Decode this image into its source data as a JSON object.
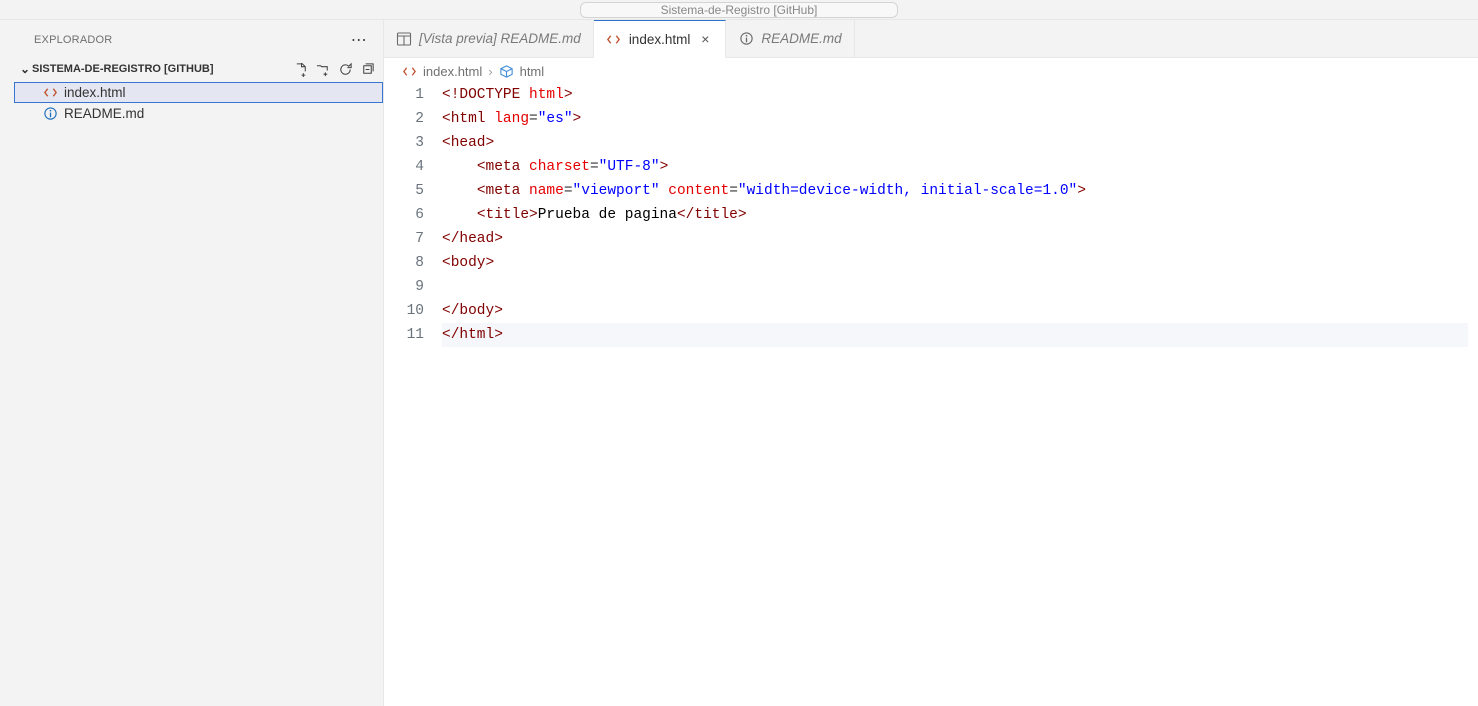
{
  "topbar": {
    "title": "Sistema-de-Registro [GitHub]"
  },
  "sidebar": {
    "title": "EXPLORADOR",
    "section": "SISTEMA-DE-REGISTRO [GITHUB]",
    "files": [
      {
        "name": "index.html",
        "icon": "html",
        "selected": true
      },
      {
        "name": "README.md",
        "icon": "info",
        "selected": false
      }
    ]
  },
  "tabs": [
    {
      "label": "[Vista previa] README.md",
      "icon": "preview",
      "active": false,
      "italic": true,
      "close": false
    },
    {
      "label": "index.html",
      "icon": "html",
      "active": true,
      "italic": false,
      "close": true
    },
    {
      "label": "README.md",
      "icon": "info",
      "active": false,
      "italic": true,
      "close": false
    }
  ],
  "breadcrumb": {
    "file": "index.html",
    "symbol": "html"
  },
  "editor": {
    "current_line": 11,
    "lines": [
      {
        "n": 1,
        "html": "<span class='t-bracket'>&lt;!</span><span class='t-doctype'>DOCTYPE</span> <span class='t-attr'>html</span><span class='t-bracket'>&gt;</span>"
      },
      {
        "n": 2,
        "html": "<span class='t-bracket'>&lt;</span><span class='t-tag'>html</span> <span class='t-attr'>lang</span>=<span class='t-string'>\"es\"</span><span class='t-bracket'>&gt;</span>"
      },
      {
        "n": 3,
        "html": "<span class='t-bracket'>&lt;</span><span class='t-tag'>head</span><span class='t-bracket'>&gt;</span>"
      },
      {
        "n": 4,
        "html": "    <span class='t-bracket'>&lt;</span><span class='t-tag'>meta</span> <span class='t-attr'>charset</span>=<span class='t-string'>\"UTF-8\"</span><span class='t-bracket'>&gt;</span>"
      },
      {
        "n": 5,
        "html": "    <span class='t-bracket'>&lt;</span><span class='t-tag'>meta</span> <span class='t-attr'>name</span>=<span class='t-string'>\"viewport\"</span> <span class='t-attr'>content</span>=<span class='t-string'>\"width=device-width, initial-scale=1.0\"</span><span class='t-bracket'>&gt;</span>"
      },
      {
        "n": 6,
        "html": "    <span class='t-bracket'>&lt;</span><span class='t-tag'>title</span><span class='t-bracket'>&gt;</span><span class='t-text'>Prueba de pagina</span><span class='t-bracket'>&lt;/</span><span class='t-tag'>title</span><span class='t-bracket'>&gt;</span>"
      },
      {
        "n": 7,
        "html": "<span class='t-bracket'>&lt;/</span><span class='t-tag'>head</span><span class='t-bracket'>&gt;</span>"
      },
      {
        "n": 8,
        "html": "<span class='t-bracket'>&lt;</span><span class='t-tag'>body</span><span class='t-bracket'>&gt;</span>"
      },
      {
        "n": 9,
        "html": ""
      },
      {
        "n": 10,
        "html": "<span class='t-bracket'>&lt;/</span><span class='t-tag'>body</span><span class='t-bracket'>&gt;</span>"
      },
      {
        "n": 11,
        "html": "<span class='t-bracket'>&lt;/</span><span class='t-tag'>html</span><span class='t-bracket'>&gt;</span>"
      }
    ]
  }
}
